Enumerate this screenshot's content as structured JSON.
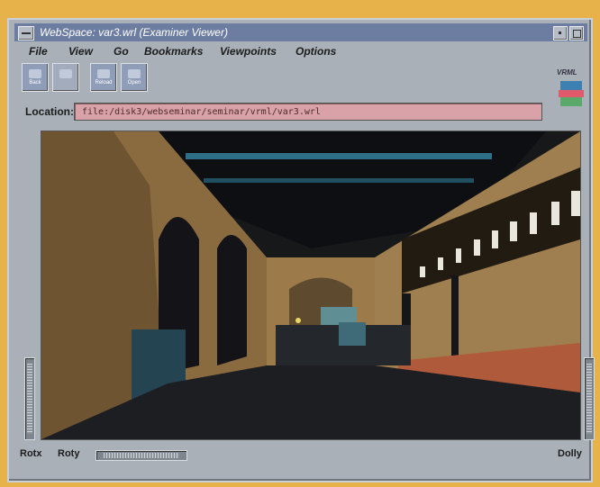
{
  "window": {
    "title": "WebSpace: var3.wrl (Examiner Viewer)"
  },
  "menu": {
    "items": [
      "File",
      "View",
      "Go",
      "Bookmarks",
      "Viewpoints",
      "Options"
    ]
  },
  "toolbar": {
    "buttons": [
      {
        "label": "Back",
        "enabled": true
      },
      {
        "label": "",
        "enabled": false
      },
      {
        "label": "Reload",
        "enabled": true
      },
      {
        "label": "Open",
        "enabled": true
      }
    ]
  },
  "logo_text": "VRML",
  "location": {
    "label": "Location:",
    "value": "file:/disk3/webseminar/seminar/vrml/var3.wrl"
  },
  "controls": {
    "rotx_label": "Rotx",
    "roty_label": "Roty",
    "dolly_label": "Dolly"
  },
  "colors": {
    "desktop": "#e8b24a",
    "window_chrome": "#a9b0b8",
    "titlebar": "#6d7da2",
    "location_field": "#d9a2a8"
  }
}
